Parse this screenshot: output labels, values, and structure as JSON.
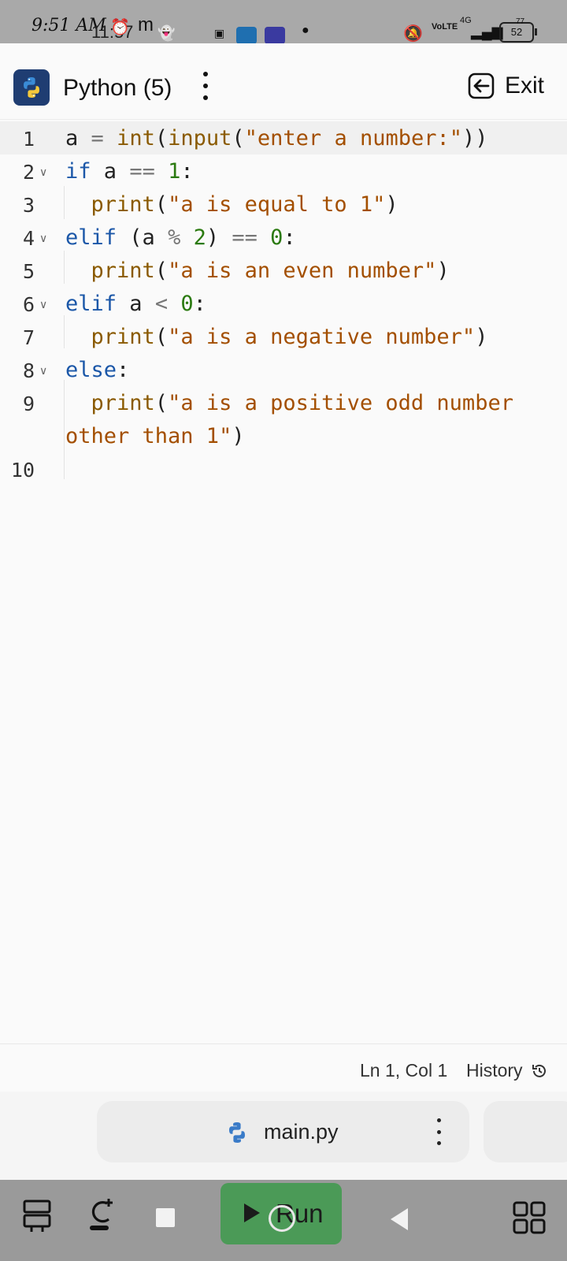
{
  "status_bar": {
    "time": "9:51 AM",
    "secondary_time": "11:57",
    "network": "4G",
    "volte": "VoLTE",
    "battery": "52",
    "battery_secondary": "77"
  },
  "header": {
    "title": "Python (5)",
    "exit_label": "Exit"
  },
  "editor": {
    "lines": [
      {
        "number": "1",
        "foldable": false
      },
      {
        "number": "2",
        "foldable": true
      },
      {
        "number": "3",
        "foldable": false
      },
      {
        "number": "4",
        "foldable": true
      },
      {
        "number": "5",
        "foldable": false
      },
      {
        "number": "6",
        "foldable": true
      },
      {
        "number": "7",
        "foldable": false
      },
      {
        "number": "8",
        "foldable": true
      },
      {
        "number": "9",
        "foldable": false
      },
      {
        "number": "10",
        "foldable": false
      }
    ],
    "code": {
      "l1_var": "a",
      "l1_eq": "=",
      "l1_int": "int",
      "l1_input": "input",
      "l1_str": "\"enter a number:\"",
      "l2_kw": "if",
      "l2_var": "a",
      "l2_op": "==",
      "l2_num": "1",
      "l3_fn": "print",
      "l3_str": "\"a is equal to 1\"",
      "l4_kw": "elif",
      "l4_var": "(a",
      "l4_op": "%",
      "l4_num": "2",
      "l4_eq": "==",
      "l4_num2": "0",
      "l5_fn": "print",
      "l5_str": "\"a is an even number\"",
      "l6_kw": "elif",
      "l6_var": "a",
      "l6_op": "<",
      "l6_num": "0",
      "l7_fn": "print",
      "l7_str": "\"a is a negative number\"",
      "l8_kw": "else",
      "l9_fn": "print",
      "l9_str_a": "\"a is a positive odd number",
      "l9_str_b": "other than 1\""
    }
  },
  "status_strip": {
    "position": "Ln 1, Col 1",
    "history_label": "History"
  },
  "file_tabs": [
    {
      "name": "main.py"
    }
  ],
  "bottom_nav": {
    "run_label": "Run"
  }
}
